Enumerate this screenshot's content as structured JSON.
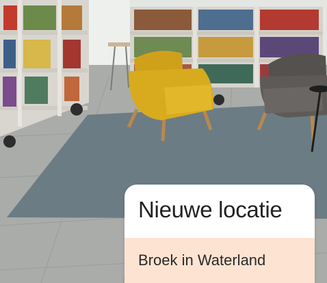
{
  "card": {
    "title": "Nieuwe locatie",
    "location": "Broek in Waterland"
  },
  "colors": {
    "card_background": "#ffffff",
    "location_band": "#fde3d2",
    "rug": "#6c7c84",
    "floor": "#a9aca9",
    "chair_yellow": "#d8ab1e",
    "chair_grey": "#5e5a57"
  }
}
